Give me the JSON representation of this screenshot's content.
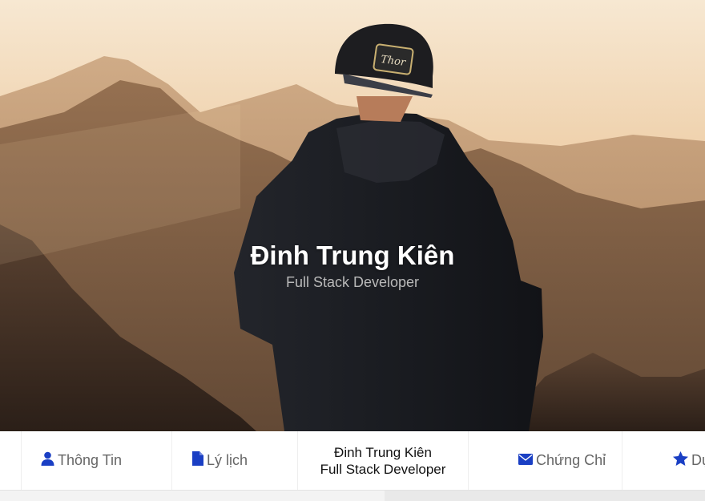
{
  "hero": {
    "name": "Đinh Trung Kiên",
    "role": "Full Stack Developer",
    "cap_logo": "Thor"
  },
  "nav": {
    "items": [
      {
        "label": "Thông Tin",
        "icon": "user-icon"
      },
      {
        "label": "Lý lịch",
        "icon": "file-icon"
      },
      {
        "label": "Chứng Chỉ",
        "icon": "envelope-icon"
      },
      {
        "label": "Dự",
        "icon": "star-icon"
      }
    ],
    "brand": {
      "name": "Đinh Trung Kiên",
      "role": "Full Stack Developer"
    }
  },
  "colors": {
    "icon_blue": "#1a3fc4",
    "nav_text": "#666666",
    "brand_text": "#111111"
  }
}
